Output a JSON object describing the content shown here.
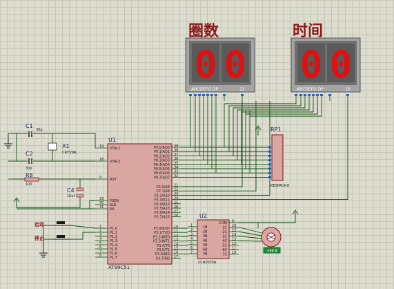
{
  "labels": {
    "lap_title": "圈数",
    "time_title": "时间"
  },
  "display_left": {
    "digits": "00",
    "pins": "ABCDEFG  DP",
    "num": "12"
  },
  "display_right": {
    "digits": "00",
    "pins": "ABCDEFG  DP",
    "num": "12"
  },
  "parts": {
    "c1": {
      "ref": "C1",
      "value": "30p"
    },
    "c2": {
      "ref": "C2",
      "value": "30p"
    },
    "x1": {
      "ref": "X1",
      "value": "CRYSTAL"
    },
    "r8": {
      "ref": "R8",
      "value": "100"
    },
    "c4": {
      "ref": "C4",
      "value": "10uf"
    },
    "u1": {
      "ref": "U1",
      "value": "AT89C51"
    },
    "u2": {
      "ref": "U2",
      "value": "ULN2003A"
    },
    "rp1": {
      "ref": "RP1",
      "value": "RESPACK-8"
    }
  },
  "switches": {
    "s1": "启动",
    "s2": "停止"
  },
  "motor": {
    "value": "+88.8"
  },
  "u1_left_pins": [
    {
      "num": "19",
      "name": "XTAL1"
    },
    {
      "num": "18",
      "name": "XTAL2"
    },
    {
      "num": "9",
      "name": "RST"
    },
    {
      "num": "29",
      "name": "PSEN"
    },
    {
      "num": "30",
      "name": "ALE"
    },
    {
      "num": "31",
      "name": "EA"
    },
    {
      "num": "1",
      "name": "P1.0"
    },
    {
      "num": "2",
      "name": "P1.1"
    },
    {
      "num": "3",
      "name": "P1.2"
    },
    {
      "num": "4",
      "name": "P1.3"
    },
    {
      "num": "5",
      "name": "P1.4"
    },
    {
      "num": "6",
      "name": "P1.5"
    },
    {
      "num": "7",
      "name": "P1.6"
    },
    {
      "num": "8",
      "name": "P1.7"
    }
  ],
  "u1_right_pins": [
    {
      "num": "39",
      "name": "P0.0/AD0"
    },
    {
      "num": "38",
      "name": "P0.1/AD1"
    },
    {
      "num": "37",
      "name": "P0.2/AD2"
    },
    {
      "num": "36",
      "name": "P0.3/AD3"
    },
    {
      "num": "35",
      "name": "P0.4/AD4"
    },
    {
      "num": "34",
      "name": "P0.5/AD5"
    },
    {
      "num": "33",
      "name": "P0.6/AD6"
    },
    {
      "num": "32",
      "name": "P0.7/AD7"
    },
    {
      "num": "21",
      "name": "P2.0/A8"
    },
    {
      "num": "22",
      "name": "P2.1/A9"
    },
    {
      "num": "23",
      "name": "P2.2/A10"
    },
    {
      "num": "24",
      "name": "P2.3/A11"
    },
    {
      "num": "25",
      "name": "P2.4/A12"
    },
    {
      "num": "26",
      "name": "P2.5/A13"
    },
    {
      "num": "27",
      "name": "P2.6/A14"
    },
    {
      "num": "28",
      "name": "P2.7/A15"
    },
    {
      "num": "10",
      "name": "P3.0/RXD"
    },
    {
      "num": "11",
      "name": "P3.1/TXD"
    },
    {
      "num": "12",
      "name": "P3.2/INT0"
    },
    {
      "num": "13",
      "name": "P3.3/INT1"
    },
    {
      "num": "14",
      "name": "P3.4/T0"
    },
    {
      "num": "15",
      "name": "P3.5/T1"
    },
    {
      "num": "16",
      "name": "P3.6/WR"
    },
    {
      "num": "17",
      "name": "P3.7/RD"
    }
  ],
  "u2_left_pins": [
    {
      "num": "1",
      "name": "1B"
    },
    {
      "num": "2",
      "name": "2B"
    },
    {
      "num": "3",
      "name": "3B"
    },
    {
      "num": "4",
      "name": "4B"
    },
    {
      "num": "5",
      "name": "5B"
    },
    {
      "num": "6",
      "name": "6B"
    },
    {
      "num": "7",
      "name": "7B"
    }
  ],
  "u2_right_pins": [
    {
      "num": "9",
      "name": "COM"
    },
    {
      "num": "16",
      "name": "1C"
    },
    {
      "num": "15",
      "name": "2C"
    },
    {
      "num": "14",
      "name": "3C"
    },
    {
      "num": "13",
      "name": "4C"
    },
    {
      "num": "12",
      "name": "5C"
    },
    {
      "num": "11",
      "name": "6C"
    },
    {
      "num": "10",
      "name": "7C"
    }
  ],
  "colors": {
    "wire": "#0b4d0b",
    "chip": "#d9a6a2",
    "chip_border": "#7a1a1a",
    "display_body": "#6e6e6e",
    "segment_on": "#e01010",
    "title": "#8b1a1a"
  }
}
